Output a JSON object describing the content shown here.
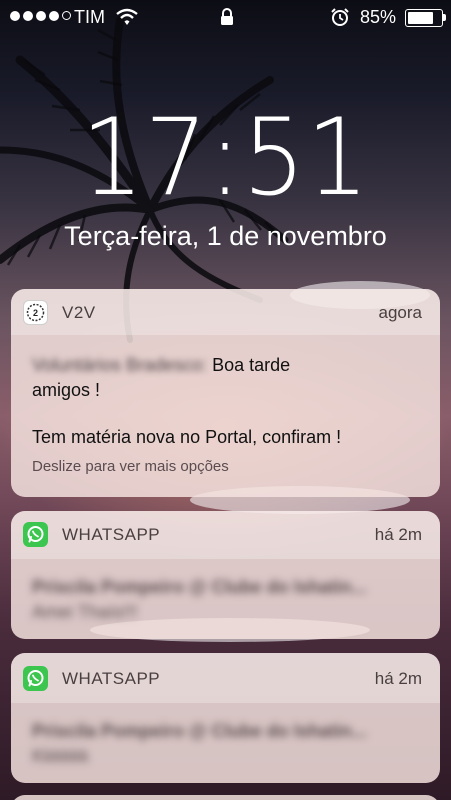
{
  "status_bar": {
    "carrier": "TIM",
    "battery_percent_label": "85%",
    "battery_level": 0.85,
    "signal_bars_filled": 4,
    "signal_bars_total": 5
  },
  "lock_screen": {
    "time": "17:51",
    "date": "Terça-feira, 1 de novembro"
  },
  "notifications": [
    {
      "app": "V2V",
      "time": "agora",
      "sender": "Voluntários Bradesco:",
      "message_line1": "Boa tarde",
      "message_line2": "amigos !",
      "message_line3": "Tem matéria nova no Portal, confiram !",
      "hint": "Deslize para ver mais opções",
      "icon": "v2v-app-icon"
    },
    {
      "app": "WHATSAPP",
      "time": "há 2m",
      "title": "Priscila Pompeiro @ Clube do Ishatin...",
      "preview": "Amei Thaís!!!",
      "icon": "whatsapp-icon"
    },
    {
      "app": "WHATSAPP",
      "time": "há 2m",
      "title": "Priscila Pompeiro @ Clube do Ishatin...",
      "preview": "Kkkkkk",
      "icon": "whatsapp-icon"
    }
  ],
  "colors": {
    "whatsapp_green": "#3cc64f",
    "card_background": "#f5e4e0"
  }
}
